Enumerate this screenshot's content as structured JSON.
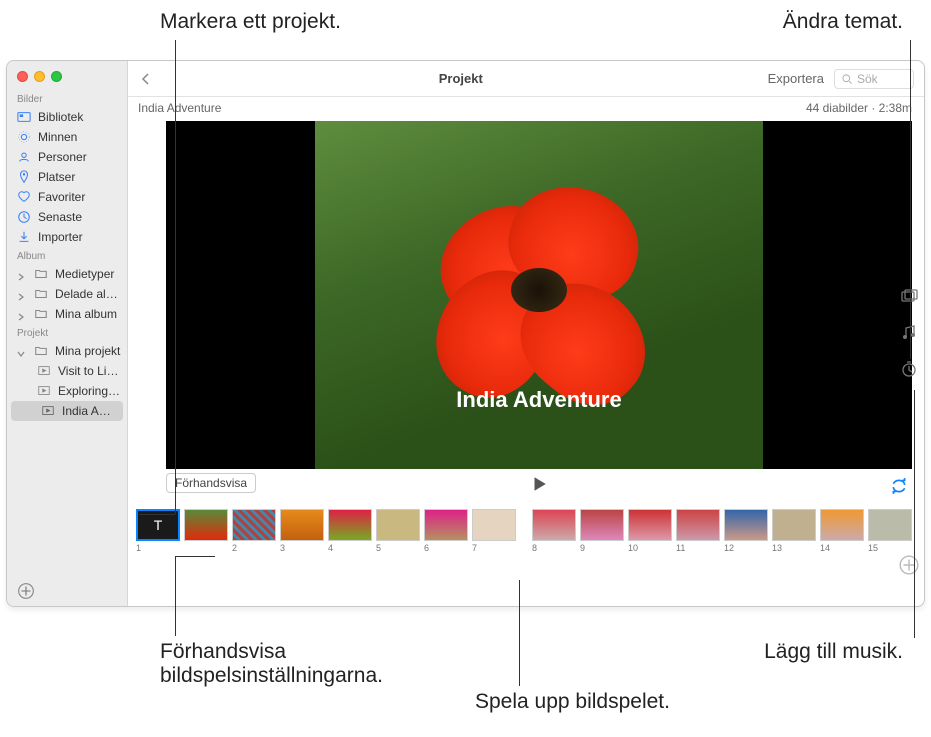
{
  "callouts": {
    "mark_project": "Markera ett projekt.",
    "change_theme": "Ändra temat.",
    "preview_settings_l1": "Förhandsvisa",
    "preview_settings_l2": "bildspelsinställningarna.",
    "play_slideshow": "Spela upp bildspelet.",
    "add_music": "Lägg till musik."
  },
  "toolbar": {
    "title": "Projekt",
    "export": "Exportera",
    "search_placeholder": "Sök"
  },
  "subheader": {
    "project_name": "India Adventure",
    "info": "44 diabilder · 2:38m"
  },
  "preview": {
    "title": "India Adventure"
  },
  "controls": {
    "preview_label": "Förhandsvisa"
  },
  "sidebar": {
    "sections": {
      "bilder": "Bilder",
      "album": "Album",
      "projekt": "Projekt"
    },
    "bilder": {
      "bibliotek": "Bibliotek",
      "minnen": "Minnen",
      "personer": "Personer",
      "platser": "Platser",
      "favoriter": "Favoriter",
      "senaste": "Senaste",
      "importer": "Importer"
    },
    "album": {
      "medietyper": "Medietyper",
      "delade": "Delade album",
      "mina": "Mina album"
    },
    "projekt": {
      "mina": "Mina projekt",
      "lisbon": "Visit to Lisbon",
      "exploring": "Exploring Mor…",
      "india": "India Adventure"
    }
  },
  "thumbs": [
    "1",
    "",
    "2",
    "3",
    "4",
    "5",
    "6",
    "7",
    "",
    "8",
    "9",
    "10",
    "11",
    "12",
    "13",
    "14",
    "15"
  ]
}
